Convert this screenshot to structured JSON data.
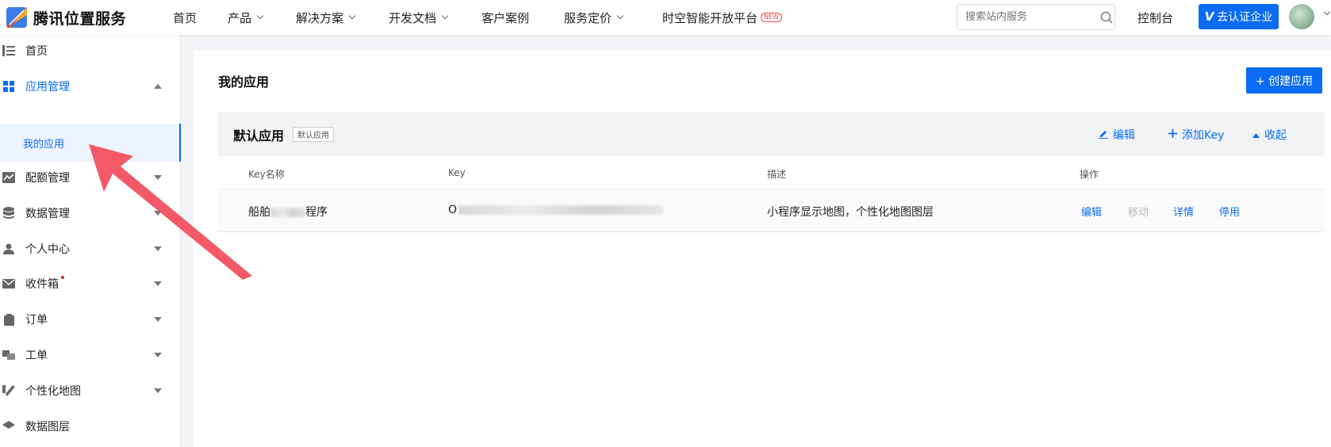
{
  "brand": {
    "name": "腾讯位置服务"
  },
  "nav": {
    "items": [
      {
        "label": "首页",
        "has_dropdown": false
      },
      {
        "label": "产品",
        "has_dropdown": true
      },
      {
        "label": "解决方案",
        "has_dropdown": true
      },
      {
        "label": "开发文档",
        "has_dropdown": true
      },
      {
        "label": "客户案例",
        "has_dropdown": false
      },
      {
        "label": "服务定价",
        "has_dropdown": true
      },
      {
        "label": "时空智能开放平台",
        "has_dropdown": false,
        "badge": "NEW"
      }
    ]
  },
  "search": {
    "placeholder": "搜索站内服务"
  },
  "header": {
    "console_label": "控制台",
    "verify_label": "去认证企业",
    "verify_icon": "V"
  },
  "sidebar": {
    "items": [
      {
        "label": "首页",
        "icon": "list-icon"
      },
      {
        "label": "应用管理",
        "icon": "grid-icon",
        "expanded": true
      },
      {
        "label": "配额管理",
        "icon": "chart-icon"
      },
      {
        "label": "数据管理",
        "icon": "database-icon"
      },
      {
        "label": "个人中心",
        "icon": "user-icon"
      },
      {
        "label": "收件箱",
        "icon": "mail-icon",
        "dot": true
      },
      {
        "label": "订单",
        "icon": "clipboard-icon"
      },
      {
        "label": "工单",
        "icon": "ticket-icon"
      },
      {
        "label": "个性化地图",
        "icon": "map-style-icon"
      },
      {
        "label": "数据图层",
        "icon": "layer-icon"
      }
    ],
    "sub_item": "我的应用"
  },
  "main": {
    "title": "我的应用",
    "create_label": "+ 创建应用",
    "app": {
      "name": "默认应用",
      "tag": "默认应用",
      "actions": {
        "edit": "编辑",
        "add_key": "添加Key",
        "collapse": "收起"
      },
      "columns": [
        "Key名称",
        "Key",
        "描述",
        "操作"
      ],
      "rows": [
        {
          "key_name_visible": "船舶",
          "key_name_tail": "程序",
          "key_prefix": "O",
          "description": "小程序显示地图，个性化地图图层",
          "ops": {
            "edit": "编辑",
            "move": "移动",
            "detail": "详情",
            "disable": "停用"
          }
        }
      ]
    }
  },
  "colors": {
    "accent": "#0a6cf5",
    "arrow": "#f2505f"
  }
}
